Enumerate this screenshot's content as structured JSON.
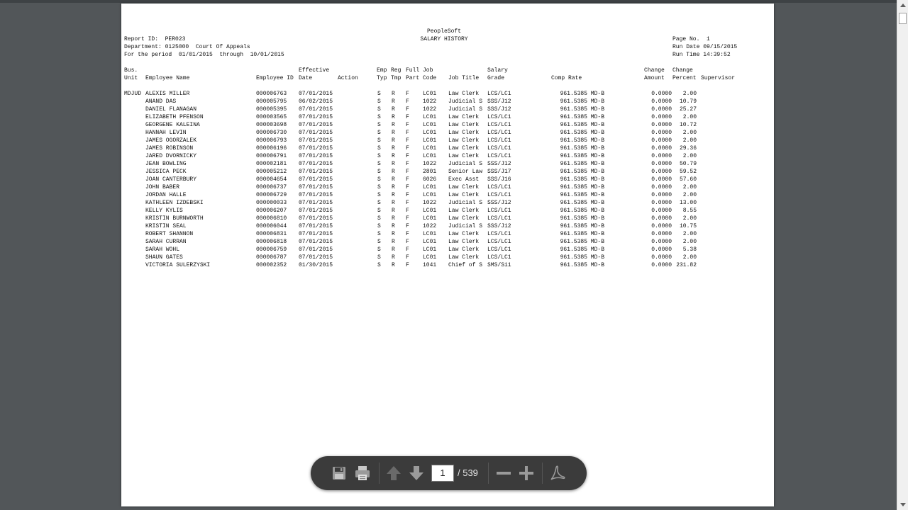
{
  "report": {
    "app": "PeopleSoft",
    "title": "SALARY HISTORY",
    "report_id": "Report ID:  PER023",
    "department": "Department: 0125000  Court Of Appeals",
    "period": "For the period  01/01/2015  through  10/01/2015",
    "page_no": "Page No.  1",
    "run_date": "Run Date 09/15/2015",
    "run_time": "Run Time 14:39:52"
  },
  "headers": {
    "bus_unit": [
      "Bus.",
      "Unit"
    ],
    "employee_name": [
      "",
      "Employee Name"
    ],
    "employee_id": [
      "",
      "Employee ID"
    ],
    "effective_date": [
      "Effective",
      "Date"
    ],
    "action": [
      "",
      "Action"
    ],
    "emp_typ": [
      "Emp",
      "Typ"
    ],
    "reg_tmp": [
      "Reg",
      "Tmp"
    ],
    "full_part": [
      "Full",
      "Part"
    ],
    "job_code": [
      "Job",
      "Code"
    ],
    "job_title": [
      "",
      "Job Title"
    ],
    "salary_grade": [
      "Salary",
      "Grade"
    ],
    "comp_rate": [
      "",
      "Comp Rate"
    ],
    "change_amount": [
      "Change",
      "Amount"
    ],
    "change_percent": [
      "Change",
      "Percent"
    ],
    "supervisor": [
      "",
      "Supervisor"
    ]
  },
  "rows": [
    {
      "unit": "MDJUD",
      "name": "ALEXIS MILLER",
      "id": "000006763",
      "date": "07/01/2015",
      "typ": "S",
      "tmp": "R",
      "part": "F",
      "code": "LC01",
      "title": "Law Clerk",
      "grade": "LCS/LC1",
      "rate": "961.5385 MD-B",
      "amount": "0.0000",
      "percent": "2.00"
    },
    {
      "unit": "",
      "name": "ANAND DAS",
      "id": "000005795",
      "date": "06/02/2015",
      "typ": "S",
      "tmp": "R",
      "part": "F",
      "code": "1022",
      "title": "Judicial S",
      "grade": "SSS/J12",
      "rate": "961.5385 MD-B",
      "amount": "0.0000",
      "percent": "10.79"
    },
    {
      "unit": "",
      "name": "DANIEL FLANAGAN",
      "id": "000005395",
      "date": "07/01/2015",
      "typ": "S",
      "tmp": "R",
      "part": "F",
      "code": "1022",
      "title": "Judicial S",
      "grade": "SSS/J12",
      "rate": "961.5385 MD-B",
      "amount": "0.0000",
      "percent": "25.27"
    },
    {
      "unit": "",
      "name": "ELIZABETH PFENSON",
      "id": "000003565",
      "date": "07/01/2015",
      "typ": "S",
      "tmp": "R",
      "part": "F",
      "code": "LC01",
      "title": "Law Clerk",
      "grade": "LCS/LC1",
      "rate": "961.5385 MD-B",
      "amount": "0.0000",
      "percent": "2.00"
    },
    {
      "unit": "",
      "name": "GEORGENE KALEINA",
      "id": "000003698",
      "date": "07/01/2015",
      "typ": "S",
      "tmp": "R",
      "part": "F",
      "code": "LC01",
      "title": "Law Clerk",
      "grade": "LCS/LC1",
      "rate": "961.5385 MD-B",
      "amount": "0.0000",
      "percent": "10.72"
    },
    {
      "unit": "",
      "name": "HANNAH LEVIN",
      "id": "000006730",
      "date": "07/01/2015",
      "typ": "S",
      "tmp": "R",
      "part": "F",
      "code": "LC01",
      "title": "Law Clerk",
      "grade": "LCS/LC1",
      "rate": "961.5385 MD-B",
      "amount": "0.0000",
      "percent": "2.00"
    },
    {
      "unit": "",
      "name": "JAMES OGORZALEK",
      "id": "000006793",
      "date": "07/01/2015",
      "typ": "S",
      "tmp": "R",
      "part": "F",
      "code": "LC01",
      "title": "Law Clerk",
      "grade": "LCS/LC1",
      "rate": "961.5385 MD-B",
      "amount": "0.0000",
      "percent": "2.00"
    },
    {
      "unit": "",
      "name": "JAMES ROBINSON",
      "id": "000006196",
      "date": "07/01/2015",
      "typ": "S",
      "tmp": "R",
      "part": "F",
      "code": "LC01",
      "title": "Law Clerk",
      "grade": "LCS/LC1",
      "rate": "961.5385 MD-B",
      "amount": "0.0000",
      "percent": "29.36"
    },
    {
      "unit": "",
      "name": "JARED DVORNICKY",
      "id": "000006791",
      "date": "07/01/2015",
      "typ": "S",
      "tmp": "R",
      "part": "F",
      "code": "LC01",
      "title": "Law Clerk",
      "grade": "LCS/LC1",
      "rate": "961.5385 MD-B",
      "amount": "0.0000",
      "percent": "2.00"
    },
    {
      "unit": "",
      "name": "JEAN BOWLING",
      "id": "000002181",
      "date": "07/01/2015",
      "typ": "S",
      "tmp": "R",
      "part": "F",
      "code": "1022",
      "title": "Judicial S",
      "grade": "SSS/J12",
      "rate": "961.5385 MD-B",
      "amount": "0.0000",
      "percent": "50.79"
    },
    {
      "unit": "",
      "name": "JESSICA PECK",
      "id": "000005212",
      "date": "07/01/2015",
      "typ": "S",
      "tmp": "R",
      "part": "F",
      "code": "2801",
      "title": "Senior Law",
      "grade": "SSS/J17",
      "rate": "961.5385 MD-B",
      "amount": "0.0000",
      "percent": "59.52"
    },
    {
      "unit": "",
      "name": "JOAN CANTERBURY",
      "id": "000004654",
      "date": "07/01/2015",
      "typ": "S",
      "tmp": "R",
      "part": "F",
      "code": "6026",
      "title": "Exec Asst",
      "grade": "SSS/J16",
      "rate": "961.5385 MD-B",
      "amount": "0.0000",
      "percent": "57.60"
    },
    {
      "unit": "",
      "name": "JOHN BABER",
      "id": "000006737",
      "date": "07/01/2015",
      "typ": "S",
      "tmp": "R",
      "part": "F",
      "code": "LC01",
      "title": "Law Clerk",
      "grade": "LCS/LC1",
      "rate": "961.5385 MD-B",
      "amount": "0.0000",
      "percent": "2.00"
    },
    {
      "unit": "",
      "name": "JORDAN HALLE",
      "id": "000006729",
      "date": "07/01/2015",
      "typ": "S",
      "tmp": "R",
      "part": "F",
      "code": "LC01",
      "title": "Law Clerk",
      "grade": "LCS/LC1",
      "rate": "961.5385 MD-B",
      "amount": "0.0000",
      "percent": "2.00"
    },
    {
      "unit": "",
      "name": "KATHLEEN IZDEBSKI",
      "id": "000000033",
      "date": "07/01/2015",
      "typ": "S",
      "tmp": "R",
      "part": "F",
      "code": "1022",
      "title": "Judicial S",
      "grade": "SSS/J12",
      "rate": "961.5385 MD-B",
      "amount": "0.0000",
      "percent": "13.00"
    },
    {
      "unit": "",
      "name": "KELLY KYLIS",
      "id": "000006207",
      "date": "07/01/2015",
      "typ": "S",
      "tmp": "R",
      "part": "F",
      "code": "LC01",
      "title": "Law Clerk",
      "grade": "LCS/LC1",
      "rate": "961.5385 MD-B",
      "amount": "0.0000",
      "percent": "8.55"
    },
    {
      "unit": "",
      "name": "KRISTIN BURNWORTH",
      "id": "000006810",
      "date": "07/01/2015",
      "typ": "S",
      "tmp": "R",
      "part": "F",
      "code": "LC01",
      "title": "Law Clerk",
      "grade": "LCS/LC1",
      "rate": "961.5385 MD-B",
      "amount": "0.0000",
      "percent": "2.00"
    },
    {
      "unit": "",
      "name": "KRISTIN SEAL",
      "id": "000006044",
      "date": "07/01/2015",
      "typ": "S",
      "tmp": "R",
      "part": "F",
      "code": "1022",
      "title": "Judicial S",
      "grade": "SSS/J12",
      "rate": "961.5385 MD-B",
      "amount": "0.0000",
      "percent": "10.75"
    },
    {
      "unit": "",
      "name": "ROBERT SHANNON",
      "id": "000006831",
      "date": "07/01/2015",
      "typ": "S",
      "tmp": "R",
      "part": "F",
      "code": "LC01",
      "title": "Law Clerk",
      "grade": "LCS/LC1",
      "rate": "961.5385 MD-B",
      "amount": "0.0000",
      "percent": "2.00"
    },
    {
      "unit": "",
      "name": "SARAH CURRAN",
      "id": "000006818",
      "date": "07/01/2015",
      "typ": "S",
      "tmp": "R",
      "part": "F",
      "code": "LC01",
      "title": "Law Clerk",
      "grade": "LCS/LC1",
      "rate": "961.5385 MD-B",
      "amount": "0.0000",
      "percent": "2.00"
    },
    {
      "unit": "",
      "name": "SARAH WOHL",
      "id": "000006759",
      "date": "07/01/2015",
      "typ": "S",
      "tmp": "R",
      "part": "F",
      "code": "LC01",
      "title": "Law Clerk",
      "grade": "LCS/LC1",
      "rate": "961.5385 MD-B",
      "amount": "0.0000",
      "percent": "5.38"
    },
    {
      "unit": "",
      "name": "SHAUN GATES",
      "id": "000006787",
      "date": "07/01/2015",
      "typ": "S",
      "tmp": "R",
      "part": "F",
      "code": "LC01",
      "title": "Law Clerk",
      "grade": "LCS/LC1",
      "rate": "961.5385 MD-B",
      "amount": "0.0000",
      "percent": "2.00"
    },
    {
      "unit": "",
      "name": "VICTORIA SULERZYSKI",
      "id": "000002352",
      "date": "01/30/2015",
      "typ": "S",
      "tmp": "R",
      "part": "F",
      "code": "1041",
      "title": "Chief of S",
      "grade": "SMS/S11",
      "rate": "961.5385 MD-B",
      "amount": "0.0000",
      "percent": "231.82"
    }
  ],
  "viewer": {
    "current_page": "1",
    "total_pages": "/ 539",
    "icons": {
      "save": "save-icon",
      "print": "print-icon",
      "prev": "arrow-up-icon",
      "next": "arrow-down-icon",
      "zoom_out": "minus-icon",
      "zoom_in": "plus-icon",
      "acrobat": "acrobat-icon"
    },
    "colors": {
      "background": "#525659",
      "toolbar": "#3b3b3b",
      "page": "#ffffff"
    }
  }
}
